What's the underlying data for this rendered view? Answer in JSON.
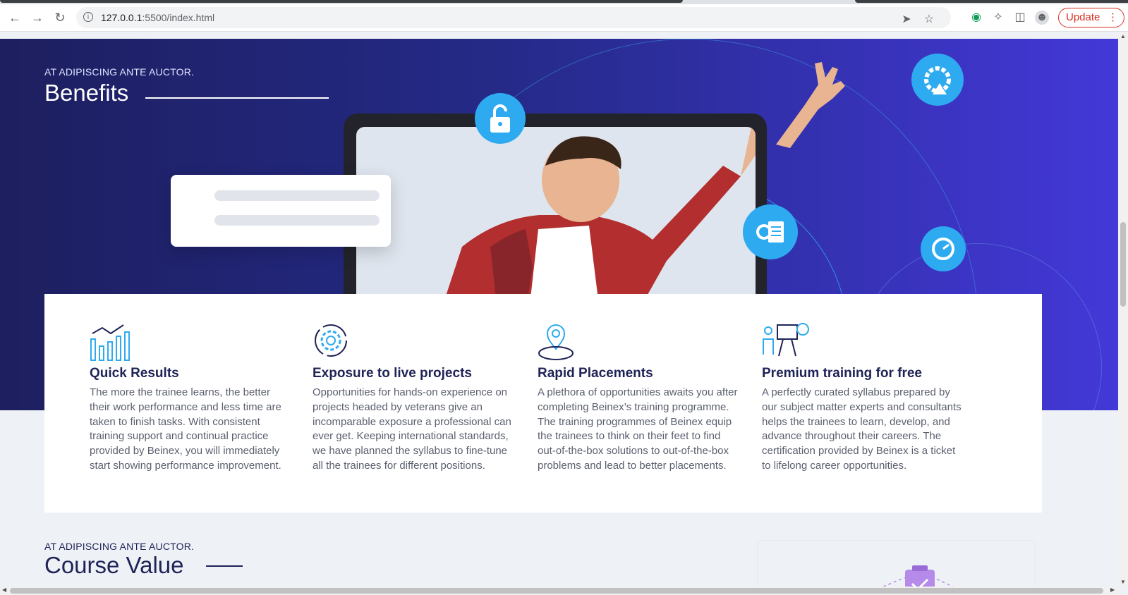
{
  "browser": {
    "url_host": "127.0.0.1",
    "url_rest": ":5500/index.html",
    "update_label": "Update"
  },
  "benefits_section": {
    "eyebrow": "AT ADIPISCING ANTE AUCTOR.",
    "title": "Benefits",
    "items": [
      {
        "title": "Quick Results",
        "text": "The more the trainee learns, the better their work performance and less time are taken to finish tasks. With consistent training support and continual practice provided by Beinex, you will immediately start showing performance improvement.",
        "icon": "bar-chart-icon"
      },
      {
        "title": "Exposure to live projects",
        "text": "Opportunities for hands-on experience on projects headed by veterans give an incomparable exposure a professional can ever get. Keeping international standards, we have planned the syllabus to fine-tune all the trainees for different positions.",
        "icon": "gear-icon"
      },
      {
        "title": "Rapid Placements",
        "text": "A plethora of opportunities awaits you after completing Beinex’s training programme. The training programmes of Beinex equip the trainees to think on their feet to find out-of-the-box solutions to out-of-the-box problems and lead to better placements.",
        "icon": "location-pin-icon"
      },
      {
        "title": "Premium training for free",
        "text": "A perfectly curated syllabus prepared by our subject matter experts and consultants helps the trainees to learn, develop, and advance throughout their careers. The certification provided by Beinex is a ticket to lifelong career opportunities.",
        "icon": "presentation-award-icon"
      }
    ]
  },
  "course_section": {
    "eyebrow": "AT ADIPISCING ANTE AUCTOR.",
    "title": "Course Value"
  },
  "colors": {
    "hero_start": "#1d1f5f",
    "hero_end": "#4338d8",
    "accent_blue": "#2eaaf0",
    "heading": "#1f2356"
  }
}
